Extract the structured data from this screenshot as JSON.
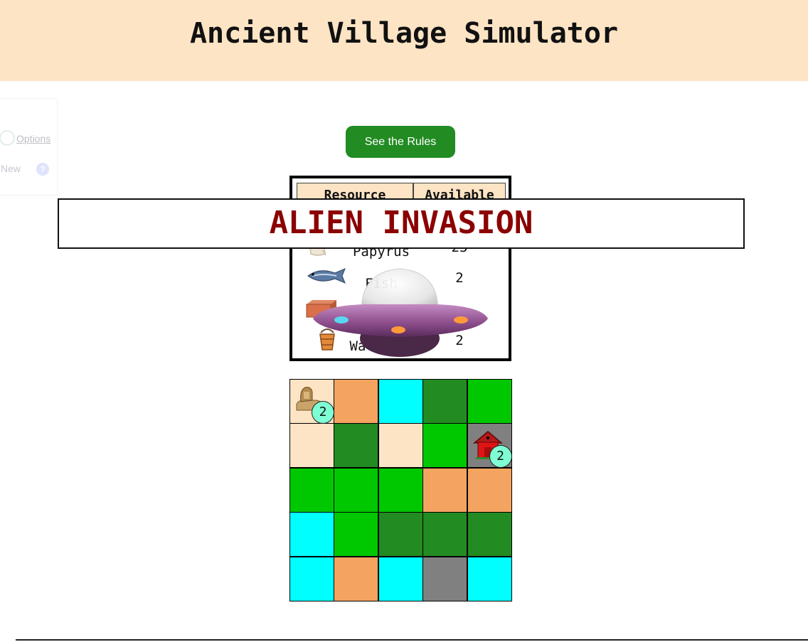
{
  "page": {
    "title": "Ancient Village Simulator"
  },
  "side_panel": {
    "options_label": "Options",
    "new_label": "New",
    "help_label": "?"
  },
  "rules_button": {
    "label": "See the Rules"
  },
  "resources": {
    "headers": [
      "Resource",
      "Available"
    ],
    "rows": [
      {
        "name": "Papyrus",
        "count": "23",
        "icon": "papyrus-scroll-icon"
      },
      {
        "name": "Fish",
        "count": "2",
        "icon": "fish-icon"
      },
      {
        "name": "",
        "count": "",
        "icon": "brick-icon"
      },
      {
        "name": "Wa",
        "count": "2",
        "icon": "water-bucket-icon"
      }
    ]
  },
  "banner": {
    "text": "ALIEN INVASION"
  },
  "map": {
    "colors": {
      "sand": "#fde4c4",
      "clay": "#f4a460",
      "water": "#00ffff",
      "forest": "#228b22",
      "grass": "#00c800",
      "stone": "#808080"
    },
    "tiles": [
      [
        "sand",
        "clay",
        "water",
        "forest",
        "grass"
      ],
      [
        "sand",
        "forest",
        "sand",
        "grass",
        "stone"
      ],
      [
        "grass",
        "grass",
        "grass",
        "clay",
        "clay"
      ],
      [
        "water",
        "grass",
        "forest",
        "forest",
        "forest"
      ],
      [
        "water",
        "clay",
        "water",
        "stone",
        "water"
      ]
    ],
    "buildings": [
      {
        "row": 0,
        "col": 0,
        "icon": "sphinx-icon",
        "count": "2"
      },
      {
        "row": 1,
        "col": 4,
        "icon": "red-house-icon",
        "count": "2"
      }
    ]
  }
}
